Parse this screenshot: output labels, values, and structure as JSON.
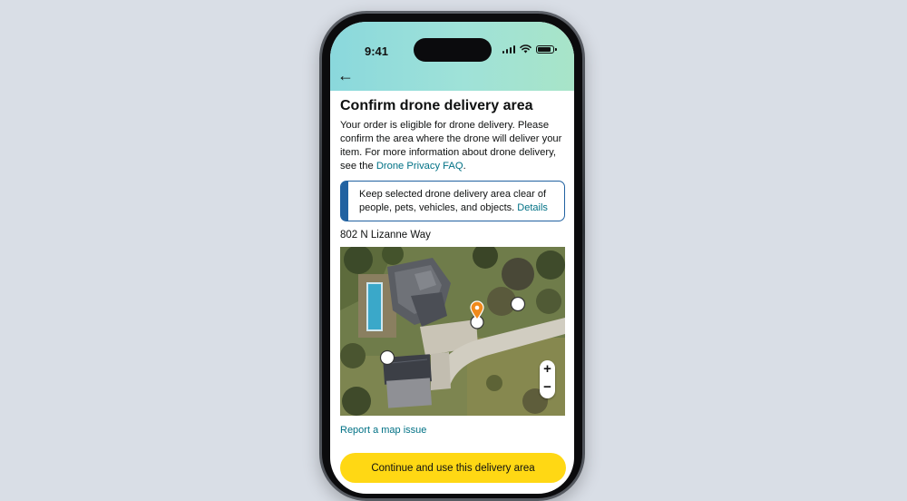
{
  "status_bar": {
    "time": "9:41"
  },
  "nav": {
    "back_icon": "←"
  },
  "page": {
    "title": "Confirm drone delivery area",
    "description": "Your order is eligible for drone delivery. Please confirm the area where the drone will deliver your item. For more information about drone delivery, see the ",
    "faq_link": "Drone Privacy FAQ",
    "description_end": "."
  },
  "alert": {
    "text": "Keep selected drone delivery area clear of people, pets, vehicles, and objects. ",
    "link": "Details",
    "accent_color": "#2162a1"
  },
  "address": "802 N Lizanne Way",
  "map": {
    "type": "satellite",
    "markers": [
      "selected-delivery-pin",
      "alternate-spot",
      "alternate-spot",
      "alternate-spot"
    ],
    "zoom_in_label": "+",
    "zoom_out_label": "−"
  },
  "report_link": "Report a map issue",
  "continue_button": {
    "label": "Continue and use this delivery area",
    "color": "#ffd814"
  },
  "colors": {
    "link": "#007185",
    "header_gradient_start": "#8ad8dc",
    "header_gradient_end": "#a8e4c8"
  }
}
